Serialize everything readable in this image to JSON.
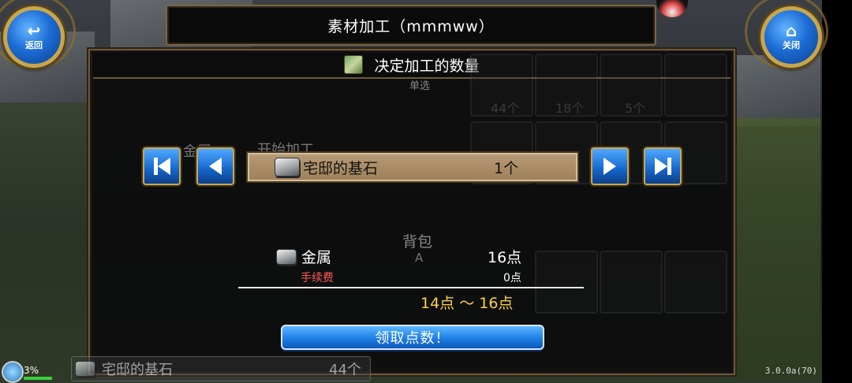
{
  "window": {
    "title": "素材加工（mmmww）"
  },
  "buttons": {
    "back": {
      "icon": "back-arrow-icon",
      "label": "返回"
    },
    "close": {
      "icon": "home-icon",
      "label": "关闭"
    }
  },
  "dialog": {
    "title": "决定加工的数量",
    "item": {
      "name": "宅邸的基石",
      "quantity": "1个"
    },
    "material": {
      "name": "金属",
      "points": "16点"
    },
    "fee": {
      "label": "手续费",
      "points": "0点"
    },
    "range": "14点 ～ 16点",
    "claim_button": "领取点数！"
  },
  "background_ui": {
    "labels": [
      "单选",
      "金属",
      "开始加工",
      "背包",
      "A"
    ],
    "counts": [
      "44个",
      "18个",
      "5个"
    ],
    "bottom_item": {
      "name": "宅邸的基石",
      "count": "44个"
    }
  },
  "status": {
    "battery_percent": "3%",
    "version": "3.0.0a(70)"
  }
}
